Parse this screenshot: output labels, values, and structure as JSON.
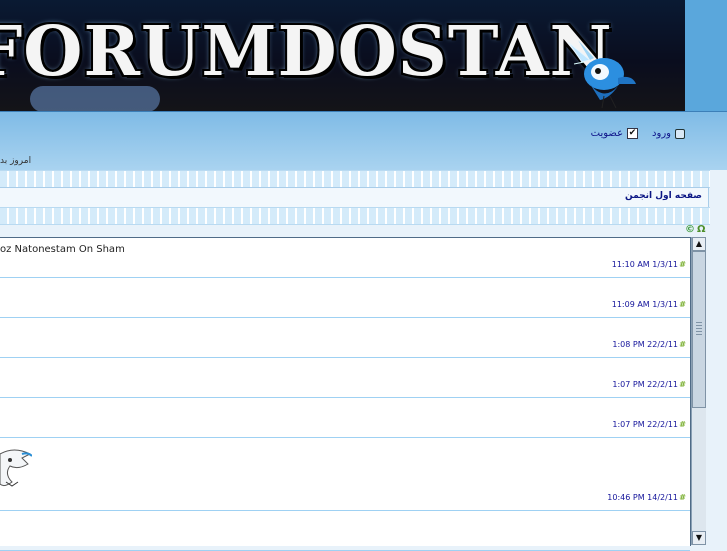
{
  "banner": {
    "title": "FORUMDOSTAN"
  },
  "topbar": {
    "login_label": "ورود",
    "register_label": "عضویت",
    "today_label": "امروز بد"
  },
  "breadcrumb": {
    "label": "صفحه اول انجمن"
  },
  "topics": [
    {
      "title": "oz Natonestam On Sham",
      "time": "11:10 AM 1/3/11"
    },
    {
      "title": "",
      "time": "11:09 AM 1/3/11"
    },
    {
      "title": "",
      "time": "1:08 PM 22/2/11"
    },
    {
      "title": "",
      "time": "1:07 PM 22/2/11"
    },
    {
      "title": "",
      "time": "1:07 PM 22/2/11"
    },
    {
      "title": "",
      "time": "10:46 PM 14/2/11"
    },
    {
      "title": "",
      "time": ""
    }
  ],
  "icons": {
    "row_arrow": "#",
    "scroll_up": "▲",
    "scroll_down": "▼"
  }
}
